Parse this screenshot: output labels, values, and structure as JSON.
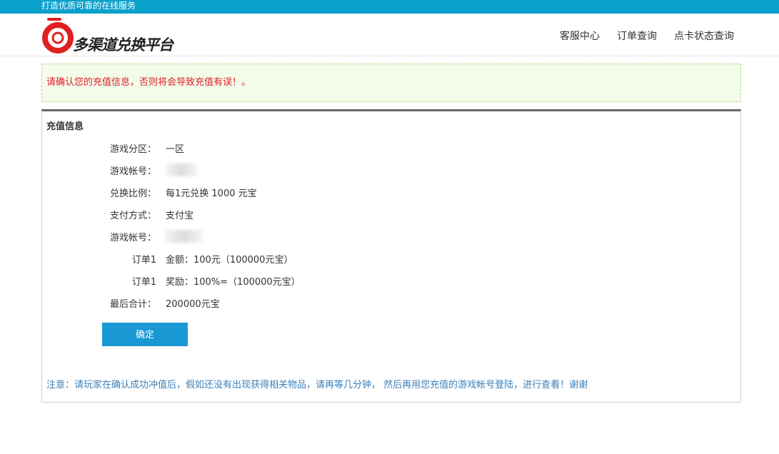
{
  "topbar": {
    "slogan": "打造优质可靠的在线服务"
  },
  "header": {
    "logo_text": "多渠道兑换平台",
    "nav": [
      "客服中心",
      "订单查询",
      "点卡状态查询"
    ]
  },
  "alert": {
    "text": "请确认您的充值信息，否则将会导致充值有误！。"
  },
  "panel": {
    "title": "充值信息",
    "rows": [
      {
        "label": "游戏分区：",
        "value": "一区"
      },
      {
        "label": "游戏帐号：",
        "value": ""
      },
      {
        "label": "兑换比例：",
        "value": "每1元兑换 1000 元宝"
      },
      {
        "label": "支付方式：",
        "value": "支付宝"
      },
      {
        "label": "游戏帐号：",
        "value": ""
      },
      {
        "label": "订单1",
        "value": "金额：100元（100000元宝）"
      },
      {
        "label": "订单1",
        "value": "奖励：100%=（100000元宝）"
      },
      {
        "label": "最后合计：",
        "value": "200000元宝"
      }
    ],
    "confirm_label": "确定",
    "note": "注意：请玩家在确认成功冲值后，假如还没有出现获得相关物品，请再等几分钟， 然后再用您充值的游戏帐号登陆，进行查看！谢谢"
  },
  "colors": {
    "topbar": "#0aa1cc",
    "button": "#1a98d4",
    "alert_text": "#e0202a",
    "note_text": "#3a7fb8"
  }
}
